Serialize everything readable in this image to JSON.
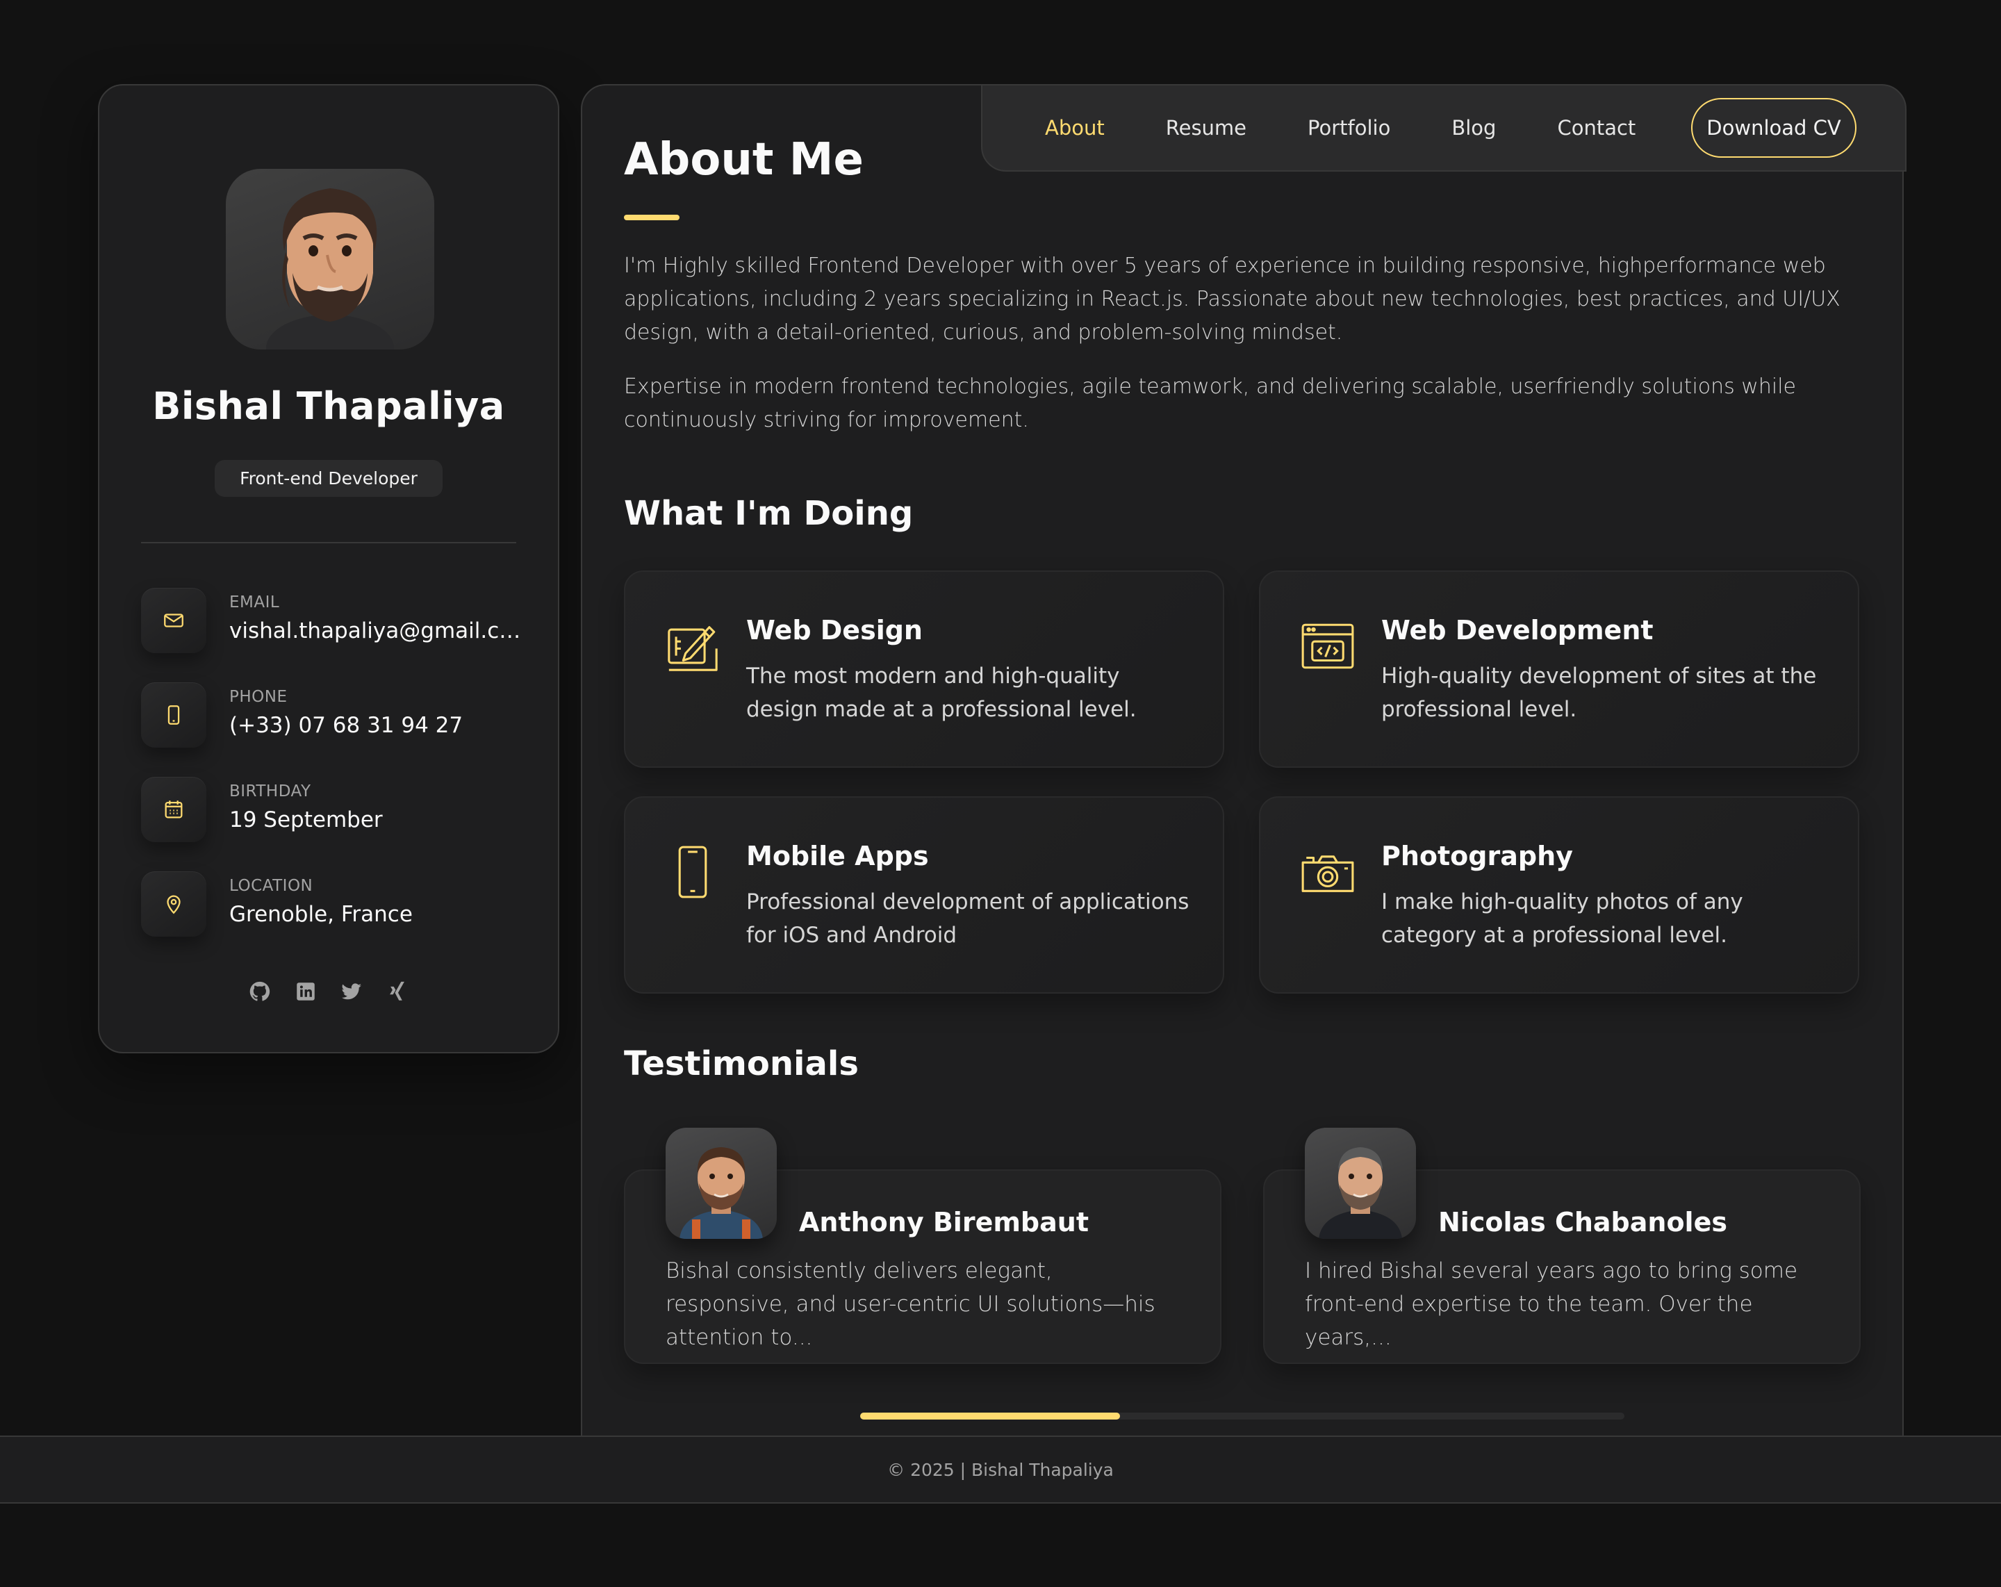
{
  "profile": {
    "name": "Bishal Thapaliya",
    "role": "Front-end Developer"
  },
  "contacts": [
    {
      "label": "EMAIL",
      "value": "vishal.thapaliya@gmail.co...",
      "icon": "mail-icon"
    },
    {
      "label": "PHONE",
      "value": "(+33) 07 68 31 94 27",
      "icon": "phone-icon"
    },
    {
      "label": "BIRTHDAY",
      "value": "19 September",
      "icon": "calendar-icon"
    },
    {
      "label": "LOCATION",
      "value": "Grenoble, France",
      "icon": "location-pin-icon"
    }
  ],
  "socials": [
    "github-icon",
    "linkedin-icon",
    "twitter-icon",
    "xing-icon"
  ],
  "nav": {
    "items": [
      "About",
      "Resume",
      "Portfolio",
      "Blog",
      "Contact"
    ],
    "active": "About",
    "cv_button": "Download CV"
  },
  "about": {
    "title": "About Me",
    "paragraphs": [
      "I'm Highly skilled Frontend Developer with over 5 years of experience in building responsive, highperformance web applications, including 2 years specializing in React.js. Passionate about new technologies, best practices, and UI/UX design, with a detail-oriented, curious, and problem-solving mindset.",
      "Expertise in modern frontend technologies, agile teamwork, and delivering scalable, userfriendly solutions while continuously striving for improvement."
    ]
  },
  "services": {
    "title": "What I'm Doing",
    "items": [
      {
        "title": "Web Design",
        "text": "The most modern and high-quality design made at a professional level.",
        "icon": "design-icon"
      },
      {
        "title": "Web Development",
        "text": "High-quality development of sites at the professional level.",
        "icon": "code-window-icon"
      },
      {
        "title": "Mobile Apps",
        "text": "Professional development of applications for iOS and Android",
        "icon": "smartphone-icon"
      },
      {
        "title": "Photography",
        "text": "I make high-quality photos of any category at a professional level.",
        "icon": "camera-icon"
      }
    ]
  },
  "testimonials": {
    "title": "Testimonials",
    "items": [
      {
        "name": "Anthony Birembaut",
        "text": "Bishal consistently delivers elegant, responsive, and user-centric UI solutions—his attention to..."
      },
      {
        "name": "Nicolas Chabanoles",
        "text": "I hired Bishal several years ago to bring some front-end expertise to the team. Over the years,..."
      }
    ],
    "scroll_progress": 0.34
  },
  "footer": {
    "text": "© 2025 | Bishal Thapaliya"
  },
  "colors": {
    "accent": "#ffdb70",
    "background": "#121212",
    "card": "#1e1e1f"
  }
}
